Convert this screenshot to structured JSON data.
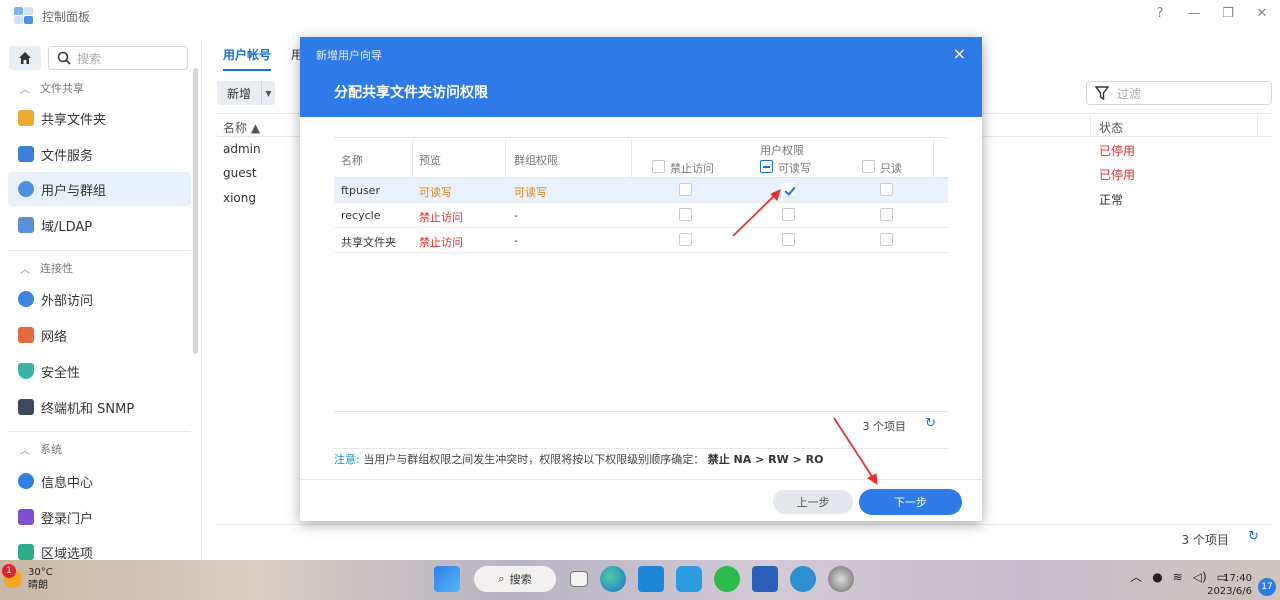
{
  "window": {
    "title": "控制面板"
  },
  "sidebar": {
    "search_placeholder": "搜索",
    "sections": [
      {
        "label": "文件共享"
      },
      {
        "label": "连接性"
      },
      {
        "label": "系统"
      }
    ],
    "items": [
      {
        "label": "共享文件夹",
        "icon": "folder-icon"
      },
      {
        "label": "文件服务",
        "icon": "file-service-icon"
      },
      {
        "label": "用户与群组",
        "icon": "users-icon",
        "active": true
      },
      {
        "label": "域/LDAP",
        "icon": "ldap-icon"
      },
      {
        "label": "外部访问",
        "icon": "external-access-icon"
      },
      {
        "label": "网络",
        "icon": "network-icon"
      },
      {
        "label": "安全性",
        "icon": "shield-icon"
      },
      {
        "label": "终端机和 SNMP",
        "icon": "terminal-icon"
      },
      {
        "label": "信息中心",
        "icon": "info-icon"
      },
      {
        "label": "登录门户",
        "icon": "portal-icon"
      },
      {
        "label": "区域选项",
        "icon": "region-icon"
      }
    ]
  },
  "main": {
    "tabs": [
      {
        "label": "用户帐号"
      },
      {
        "label": "用户"
      }
    ],
    "add_label": "新增",
    "filter_placeholder": "过滤",
    "columns": {
      "name": "名称 ▲",
      "status": "状态"
    },
    "users": [
      {
        "name": "admin",
        "status": "已停用"
      },
      {
        "name": "guest",
        "status": "已停用"
      },
      {
        "name": "xiong",
        "status": "正常"
      }
    ],
    "count": "3 个项目"
  },
  "dialog": {
    "wizard_title": "新增用户向导",
    "close": "×",
    "step_title": "分配共享文件夹访问权限",
    "columns": {
      "name": "名称",
      "preview": "预览",
      "group_perm": "群组权限",
      "user_perm": "用户权限",
      "no_access": "禁止访问",
      "read_write": "可读写",
      "read_only": "只读"
    },
    "rows": [
      {
        "name": "ftpuser",
        "preview": "可读写",
        "group": "可读写",
        "no_access": false,
        "read_write": true,
        "read_only": false
      },
      {
        "name": "recycle",
        "preview": "禁止访问",
        "group": "-",
        "no_access": false,
        "read_write": false,
        "read_only": false
      },
      {
        "name": "共享文件夹",
        "preview": "禁止访问",
        "group": "-",
        "no_access": false,
        "read_write": false,
        "read_only": false
      }
    ],
    "count": "3 个项目",
    "note_label": "注意:",
    "note_text": "当用户与群组权限之间发生冲突时，权限将按以下权限级别顺序确定：",
    "note_order": "禁止 NA > RW > RO",
    "prev_label": "上一步",
    "next_label": "下一步"
  },
  "taskbar": {
    "weather_temp": "30°C",
    "weather_desc": "晴朗",
    "weather_badge": "1",
    "search_label": "搜索",
    "time": "17:40",
    "date": "2023/6/6",
    "notif_count": "17"
  },
  "colors": {
    "accent": "#2e7ae8",
    "danger": "#e0302a",
    "warning": "#e8801a"
  }
}
